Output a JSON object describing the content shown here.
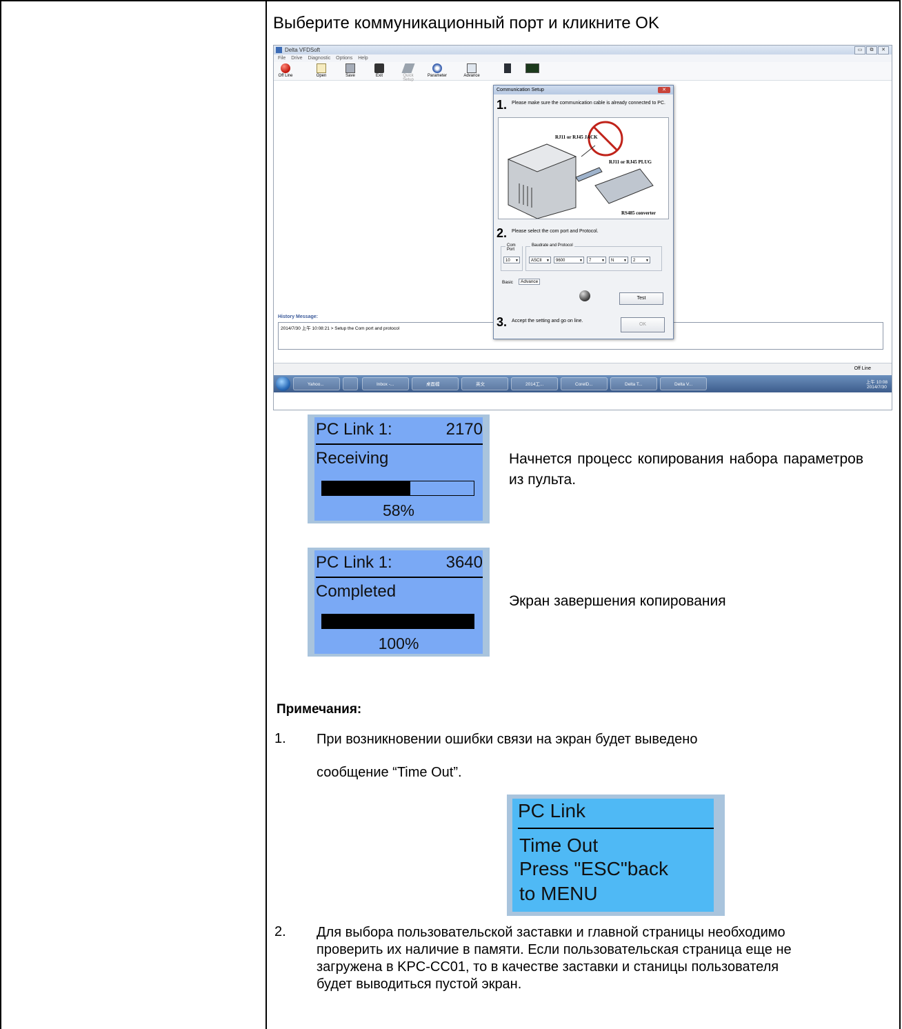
{
  "intro": "Выберите коммуникационный порт и кликните OK",
  "app": {
    "title": "Delta VFDSoft",
    "window_buttons": [
      "▭",
      "⧉",
      "✕"
    ],
    "menu": [
      "File",
      "Drive",
      "Diagnostic",
      "Options",
      "Help"
    ],
    "toolbar": [
      "Off Line",
      "Open",
      "Save",
      "Exit",
      "Quick Setup",
      "Parameter",
      "Advance"
    ],
    "history_label": "History Message:",
    "history_entry": "2014/7/30 上午 10:08:21 > Setup the Com port and protocol",
    "status": "Off Line",
    "taskbar": [
      "Yahoo...",
      "Inbox -...",
      "桌面檔",
      "英文",
      "2014工...",
      "CorelD...",
      "Delta T...",
      "Delta V..."
    ],
    "clock_time": "上午 10:08",
    "clock_date": "2014/7/30"
  },
  "dialog": {
    "title": "Communication Setup",
    "close": "✕",
    "step1_num": "1.",
    "step1_text": "Please make sure the communication cable is already connected to PC.",
    "pic_label_jack": "RJ11 or RJ45 JACK",
    "pic_label_plug": "RJ11 or RJ45 PLUG",
    "pic_label_conv": "RS485 converter",
    "step2_num": "2.",
    "step2_text": "Please select the com port and Protocol.",
    "com_port_label": "Com Port",
    "baud_label": "Baudrate and Protocol",
    "com_port": "10",
    "protocol": "ASCII",
    "baud": "9600",
    "data_bits": "7",
    "parity": "N",
    "stop_bits": "2",
    "tab_basic": "Basic",
    "tab_advance": "Advance",
    "test": "Test",
    "step3_num": "3.",
    "step3_text": "Accept the setting and go on line.",
    "ok": "OK"
  },
  "lcd_receiving": {
    "title": "PC Link 1:",
    "count": "2170",
    "status": "Receiving",
    "progress": 0.58,
    "percent": "58%"
  },
  "lcd_receiving_desc": "Начнется процесс копирования набора параметров из пульта.",
  "lcd_completed": {
    "title": "PC Link 1:",
    "count": "3640",
    "status": "Completed",
    "progress": 1.0,
    "percent": "100%"
  },
  "lcd_completed_desc": "Экран завершения копирования",
  "notes": {
    "title": "Примечания:",
    "n1": "1.",
    "n1_line1": "При возникновении ошибки связи на экран будет выведено",
    "n1_line2": "сообщение “Time Out”.",
    "n2": "2.",
    "n2_text": "Для выбора пользовательской заставки и главной страницы необходимо проверить их наличие в памяти. Если пользовательская страница еще не загружена в   KPC-CC01, то в качестве заставки и станицы пользователя будет выводиться пустой экран."
  },
  "lcd_timeout": {
    "l1": "PC Link",
    "l2": "Time Out",
    "l3": "Press \"ESC\"back",
    "l4": "to MENU"
  }
}
